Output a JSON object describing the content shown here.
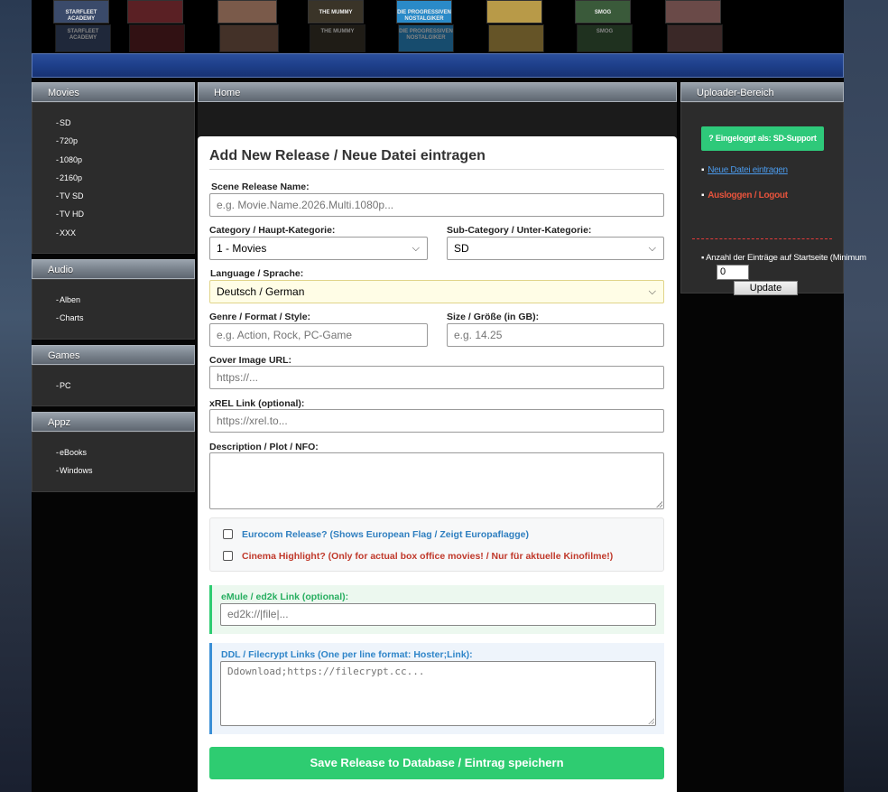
{
  "colors": {
    "accent_green": "#2ecc71",
    "link_blue": "#4a98e8",
    "logout_red": "#e6533c",
    "nav_blue": "#1e3f8a"
  },
  "banner": {
    "posters": [
      {
        "caption": "STARFLEET ACADEMY",
        "color": "#3a4a6a"
      },
      {
        "caption": "",
        "color": "#5a2024"
      },
      {
        "caption": "",
        "color": "#7a5a4a"
      },
      {
        "caption": "THE MUMMY",
        "color": "#3a3428"
      },
      {
        "caption": "DIE PROGRESSIVEN NOSTALGIKER",
        "color": "#2a8ac8"
      },
      {
        "caption": "",
        "color": "#b89a48"
      },
      {
        "caption": "SMOG",
        "color": "#3a5a3a"
      },
      {
        "caption": "",
        "color": "#6a4a48"
      }
    ]
  },
  "left_menu": [
    {
      "title": "Movies",
      "items": [
        "SD",
        "720p",
        "1080p",
        "2160p",
        "TV SD",
        "TV HD",
        "XXX"
      ]
    },
    {
      "title": "Audio",
      "items": [
        "Alben",
        "Charts"
      ]
    },
    {
      "title": "Games",
      "items": [
        "PC"
      ]
    },
    {
      "title": "Appz",
      "items": [
        "eBooks",
        "Windows"
      ]
    }
  ],
  "center": {
    "breadcrumb": "Home"
  },
  "form": {
    "title": "Add New Release / Neue Datei eintragen",
    "scene_name": {
      "label": "Scene Release Name:",
      "placeholder": "e.g. Movie.Name.2026.Multi.1080p..."
    },
    "category": {
      "label": "Category / Haupt-Kategorie:",
      "value": "1 - Movies"
    },
    "subcategory": {
      "label": "Sub-Category / Unter-Kategorie:",
      "value": "SD"
    },
    "language": {
      "label": "Language / Sprache:",
      "value": "Deutsch / German"
    },
    "genre": {
      "label": "Genre / Format / Style:",
      "placeholder": "e.g. Action, Rock, PC-Game"
    },
    "size": {
      "label": "Size / Größe (in GB):",
      "placeholder": "e.g. 14.25"
    },
    "cover": {
      "label": "Cover Image URL:",
      "placeholder": "https://..."
    },
    "xrel": {
      "label": "xREL Link (optional):",
      "placeholder": "https://xrel.to..."
    },
    "description": {
      "label": "Description / Plot / NFO:",
      "placeholder": ""
    },
    "eurocom": {
      "label": "Eurocom Release? (Shows European Flag / Zeigt Europaflagge)",
      "checked": false
    },
    "cinema": {
      "label": "Cinema Highlight? (Only for actual box office movies! / Nur für aktuelle Kinofilme!)",
      "checked": false
    },
    "emule": {
      "label": "eMule / ed2k Link (optional):",
      "placeholder": "ed2k://|file|..."
    },
    "ddl": {
      "label": "DDL / Filecrypt Links (One per line format: Hoster;Link):",
      "placeholder": "Ddownload;https://filecrypt.cc..."
    },
    "submit": "Save Release to Database / Eintrag speichern"
  },
  "uploader": {
    "title": "Uploader-Bereich",
    "logged_in": "? Eingeloggt als: SD-Support",
    "new_file": "Neue Datei eintragen",
    "logout": "Ausloggen / Logout",
    "count_label": "Anzahl der Einträge auf Startseite (Minimum",
    "count_value": "0",
    "update": "Update"
  }
}
